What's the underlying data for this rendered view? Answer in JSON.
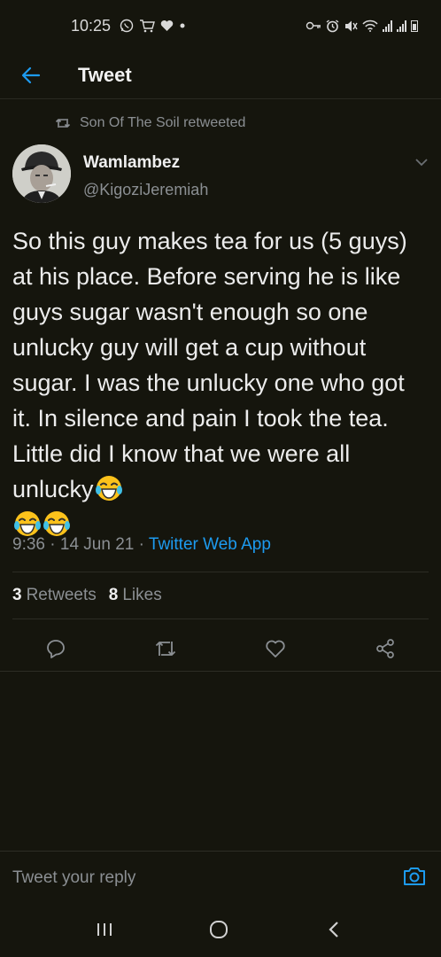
{
  "status_bar": {
    "time": "10:25",
    "icons": [
      "whatsapp-icon",
      "shopping-cart-icon",
      "heart-icon",
      "dot-icon",
      "key-icon",
      "alarm-icon",
      "mute-icon",
      "wifi-icon",
      "signal-icon",
      "signal-icon",
      "battery-icon"
    ]
  },
  "header": {
    "title": "Tweet"
  },
  "retweet": {
    "text": "Son Of The Soil retweeted"
  },
  "author": {
    "name": "Wamlambez",
    "handle": "@KigoziJeremiah"
  },
  "tweet": {
    "text": "So this guy makes tea for us (5 guys) at his place. Before serving he is like guys sugar wasn't enough so one unlucky guy will get a cup without sugar. I was the unlucky one who got it. In silence and pain I took the tea. Little did I know that we were all unlucky",
    "emojis": [
      "face-with-tears-of-joy",
      "face-with-tears-of-joy",
      "face-with-tears-of-joy"
    ],
    "time": "9:36",
    "date": "14 Jun 21",
    "separator": "·",
    "source": "Twitter Web App"
  },
  "stats": {
    "retweets_count": "3",
    "retweets_label": "Retweets",
    "likes_count": "8",
    "likes_label": "Likes"
  },
  "reply": {
    "placeholder": "Tweet your reply"
  },
  "colors": {
    "background": "#15150d",
    "accent": "#1d9bf0",
    "secondary_text": "#8b8f93"
  }
}
